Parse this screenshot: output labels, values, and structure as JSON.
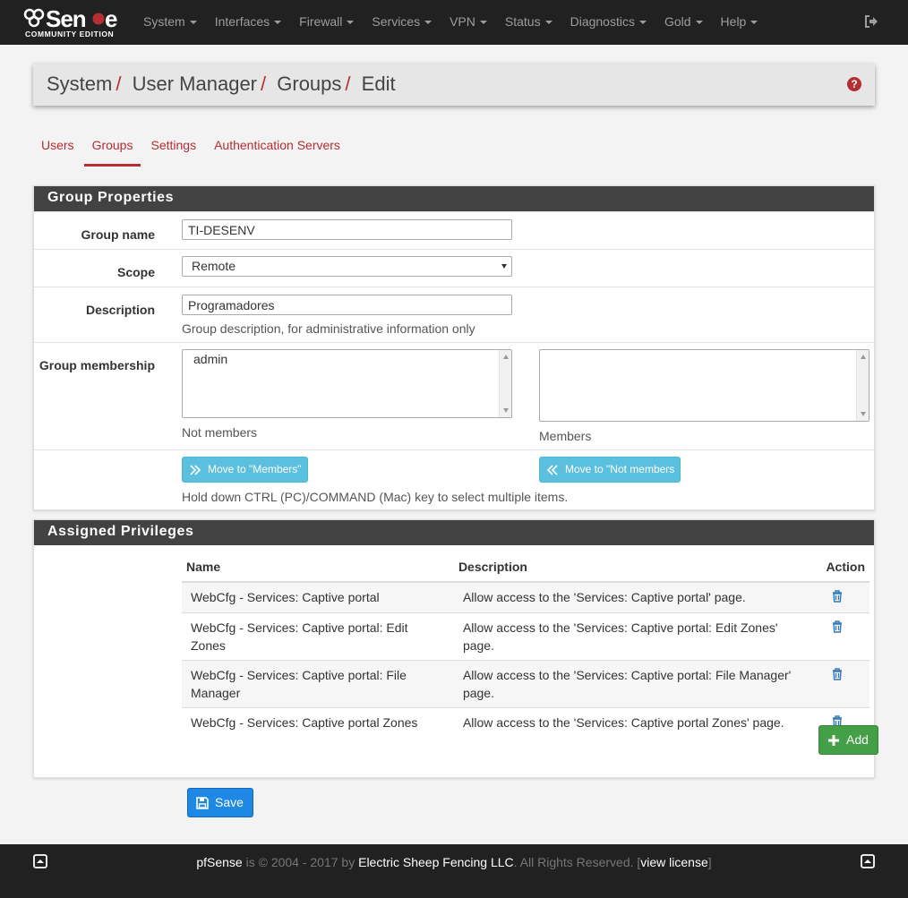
{
  "brand": {
    "logo_text": "pfSense",
    "edition": "COMMUNITY EDITION"
  },
  "nav": {
    "items": [
      {
        "label": "System"
      },
      {
        "label": "Interfaces"
      },
      {
        "label": "Firewall"
      },
      {
        "label": "Services"
      },
      {
        "label": "VPN"
      },
      {
        "label": "Status"
      },
      {
        "label": "Diagnostics"
      },
      {
        "label": "Gold"
      },
      {
        "label": "Help"
      }
    ]
  },
  "breadcrumb": {
    "items": [
      "System",
      "User Manager",
      "Groups",
      "Edit"
    ],
    "separator": "/"
  },
  "tabs": [
    {
      "label": "Users",
      "active": false
    },
    {
      "label": "Groups",
      "active": true
    },
    {
      "label": "Settings",
      "active": false
    },
    {
      "label": "Authentication Servers",
      "active": false
    }
  ],
  "group_properties": {
    "heading": "Group Properties",
    "group_name_label": "Group name",
    "group_name_value": "TI-DESENV",
    "scope_label": "Scope",
    "scope_value": "Remote",
    "description_label": "Description",
    "description_value": "Programadores",
    "description_help": "Group description, for administrative information only",
    "membership_label": "Group membership",
    "not_members_options": [
      "admin"
    ],
    "not_members_label": "Not members",
    "members_options": [],
    "members_label": "Members",
    "move_to_members_label": "Move to \"Members\"",
    "move_to_not_members_label": "Move to \"Not members",
    "multi_select_help": "Hold down CTRL (PC)/COMMAND (Mac) key to select multiple items."
  },
  "privileges": {
    "heading": "Assigned Privileges",
    "columns": [
      "Name",
      "Description",
      "Action"
    ],
    "rows": [
      {
        "name": "WebCfg - Services: Captive portal",
        "description": "Allow access to the 'Services: Captive portal' page."
      },
      {
        "name": "WebCfg - Services: Captive portal: Edit Zones",
        "description": "Allow access to the 'Services: Captive portal: Edit Zones' page."
      },
      {
        "name": "WebCfg - Services: Captive portal: File Manager",
        "description": "Allow access to the 'Services: Captive portal: File Manager' page."
      },
      {
        "name": "WebCfg - Services: Captive portal Zones",
        "description": "Allow access to the 'Services: Captive portal Zones' page."
      }
    ],
    "add_label": "Add"
  },
  "save_label": "Save",
  "footer": {
    "product": "pfSense",
    "copyright": " is © 2004 - 2017 by ",
    "company": "Electric Sheep Fencing LLC",
    "rights": ". All Rights Reserved. [",
    "license_link": "view license",
    "close_bracket": "]"
  },
  "colors": {
    "navbar": "#212121",
    "accent": "#b52e31",
    "panel_heading": "#424242",
    "info_button": "#5bc0de",
    "success_button": "#43a047",
    "primary_button": "#1e88e5"
  }
}
